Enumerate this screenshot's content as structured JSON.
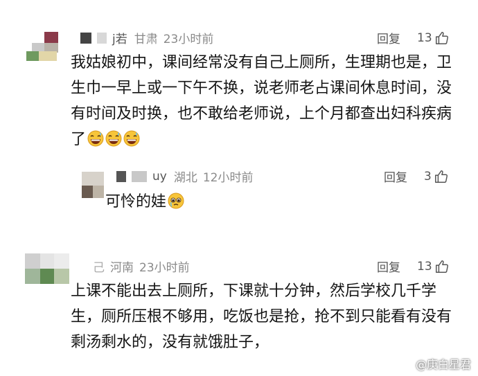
{
  "comments": [
    {
      "user": {
        "name": "j若",
        "location": "甘肃",
        "time": "23小时前"
      },
      "reply_label": "回复",
      "likes": "13",
      "text": "我姑娘初中，课间经常没有自己上厕所，生理期也是，卫生巾一早上或一下午不换，说老师老占课间休息时间，没有时间及时换，也不敢给老师说，上个月都查出妇科疾病了",
      "emoji": [
        "grinning-sweat-emoji",
        "grinning-sweat-emoji",
        "grinning-sweat-emoji"
      ]
    },
    {
      "user": {
        "name": "uy",
        "location": "湖北",
        "time": "12小时前"
      },
      "reply_label": "回复",
      "likes": "3",
      "text": "可怜的娃",
      "emoji": [
        "pleading-emoji"
      ]
    },
    {
      "user": {
        "name": "己",
        "location": "河南",
        "time": "23小时前"
      },
      "reply_label": "回复",
      "likes": "13",
      "text": "上课不能出去上厕所，下课就十分钟，然后学校几千学生，厕所压根不够用，吃饭也是抢，抢不到只能看有没有剩汤剩水的，没有就饿肚子，"
    }
  ],
  "watermark": {
    "text": "@庚白星君"
  },
  "colors": {
    "meta_gray": "#8a8a8a",
    "text": "#141414",
    "emoji_yellow": "#f7c53a"
  }
}
